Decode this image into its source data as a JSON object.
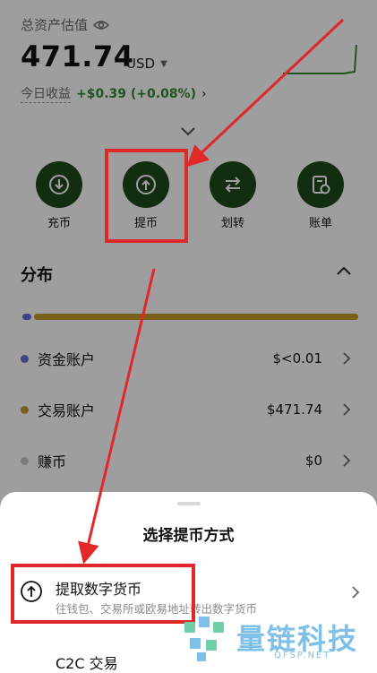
{
  "header": {
    "asset_label": "总资产估值",
    "amount": "471.74",
    "currency": "USD",
    "today_label": "今日收益",
    "today_value": "+$0.39 (+0.08%)"
  },
  "actions": [
    {
      "label": "充币",
      "icon": "arrow-down-circle-icon"
    },
    {
      "label": "提币",
      "icon": "arrow-up-circle-icon"
    },
    {
      "label": "划转",
      "icon": "swap-arrows-icon"
    },
    {
      "label": "账单",
      "icon": "bill-clock-icon"
    }
  ],
  "distribution": {
    "title": "分布",
    "rows": [
      {
        "name": "资金账户",
        "amount": "$<0.01",
        "color": "#6b6bd6"
      },
      {
        "name": "交易账户",
        "amount": "$471.74",
        "color": "#c59a2c"
      },
      {
        "name": "赚币",
        "amount": "$0",
        "color": "#c8c8c8"
      }
    ]
  },
  "sheet": {
    "title": "选择提币方式",
    "option1_title": "提取数字货币",
    "option1_subtitle": "往钱包、交易所或欧易地址转出数字货币",
    "option2_title": "C2C 交易"
  },
  "watermark": {
    "text": "量链科技",
    "url": "QFSP.NET"
  },
  "colors": {
    "action_circle": "#1f4a1a",
    "positive": "#2f8a2f",
    "annotation_red": "#e02828"
  }
}
